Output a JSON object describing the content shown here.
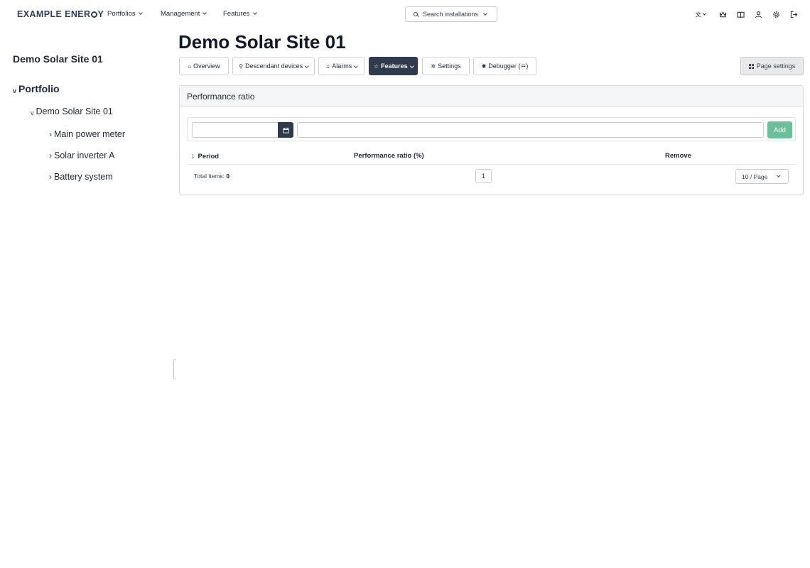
{
  "brand": {
    "text_before": "EXAMPLE ENER",
    "text_after": "Y"
  },
  "nav": {
    "menus": [
      "Portfolios",
      "Management",
      "Features"
    ],
    "search_label": "Search installations",
    "icons": [
      "translate-icon",
      "crown-icon",
      "book-icon",
      "user-icon",
      "gear-icon",
      "logout-icon"
    ]
  },
  "sidebar": {
    "title": "Demo Solar Site 01",
    "tree": {
      "root": "Portfolio",
      "site": "Demo Solar Site 01",
      "children": [
        "Main power meter",
        "Solar inverter A",
        "Battery system"
      ]
    }
  },
  "main": {
    "title": "Demo Solar Site 01",
    "tabs": [
      "Overview",
      "Descendant devices",
      "Alarms",
      "Features",
      "Settings",
      "Debugger (♒)"
    ],
    "active_tab": "Features",
    "page_settings_label": "Page settings"
  },
  "card": {
    "title": "Performance ratio",
    "add_label": "Add",
    "columns": [
      "Period",
      "Performance ratio (%)",
      "Remove"
    ],
    "rows": [],
    "total_label": "Total items: ",
    "total_count": "0",
    "current_page": "1",
    "page_size": "10 / Page"
  },
  "colors": {
    "accent_dark": "#2f3b4c",
    "add_button": "#6cbf9b",
    "brand_text": "#2f4156"
  }
}
